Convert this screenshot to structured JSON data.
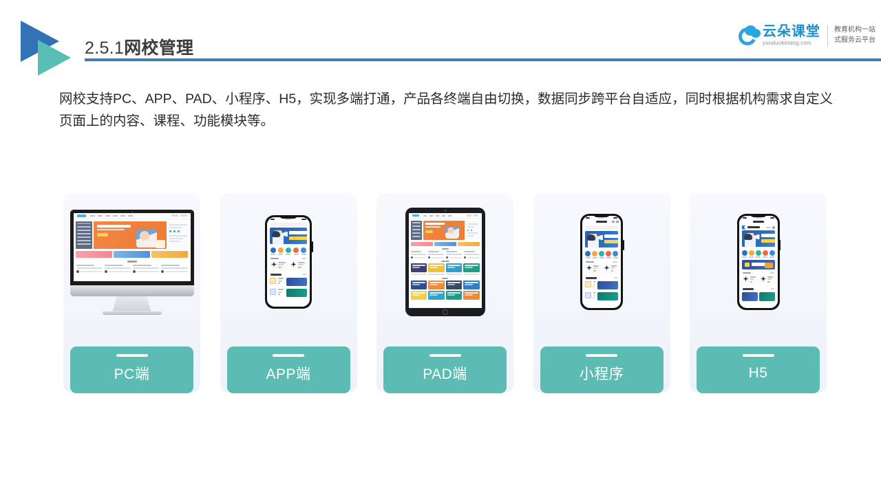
{
  "header": {
    "title_number": "2.5.1",
    "title_name": "网校管理",
    "logo_mark_name": "double-triangle-logo"
  },
  "brand": {
    "name_cn": "云朵课堂",
    "url": "yunduoketang.com",
    "tagline_line1": "教育机构一站",
    "tagline_line2": "式服务云平台",
    "accent_blue": "#1e8fd0"
  },
  "content": {
    "lead_paragraph": "网校支持PC、APP、PAD、小程序、H5，实现多端打通，产品各终端自由切换，数据同步跨平台自适应，同时根据机构需求自定义页面上的内容、课程、功能模块等。"
  },
  "theme": {
    "teal": "#5cbcb3",
    "rule_blue": "#3e7cb8",
    "triangle_blue": "#3273b5",
    "triangle_teal": "#59bfb5",
    "card_bg_top": "#f7f9fd",
    "card_bg_bottom": "#eef2f9"
  },
  "cards": [
    {
      "label": "PC端",
      "device": "desktop-monitor"
    },
    {
      "label": "APP端",
      "device": "smartphone"
    },
    {
      "label": "PAD端",
      "device": "tablet"
    },
    {
      "label": "小程序",
      "device": "smartphone-miniprogram"
    },
    {
      "label": "H5",
      "device": "smartphone-h5"
    }
  ]
}
